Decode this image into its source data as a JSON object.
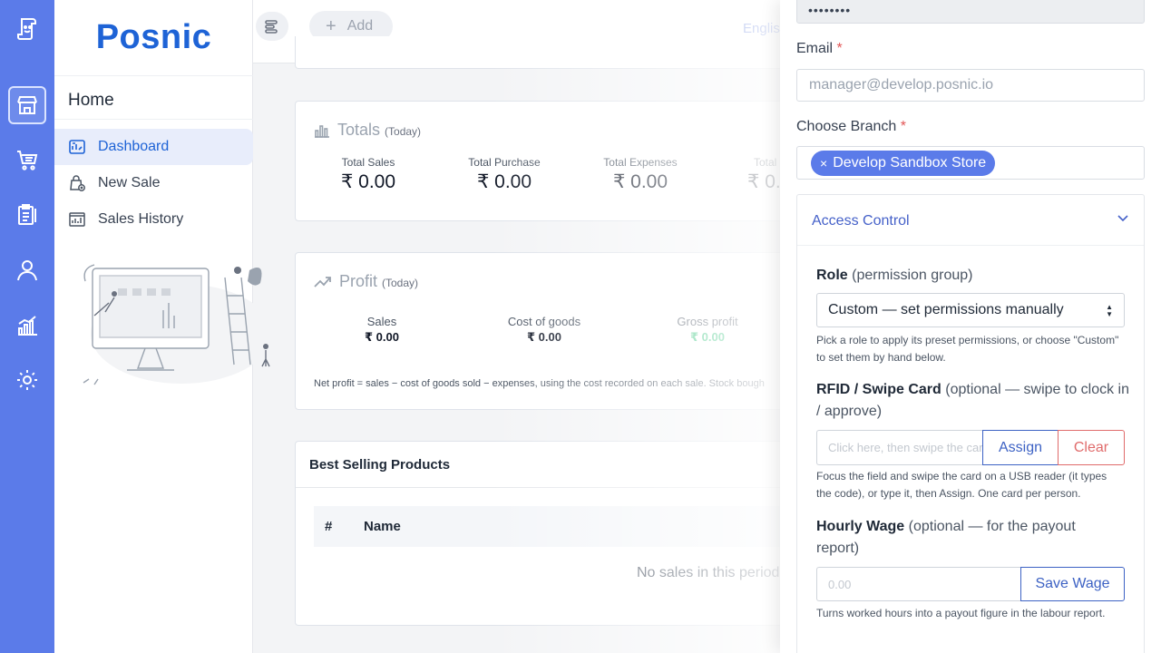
{
  "brand": {
    "name": "Posnic"
  },
  "sidebar": {
    "section_title": "Home",
    "items": [
      {
        "label": "Dashboard",
        "active": true
      },
      {
        "label": "New Sale",
        "active": false
      },
      {
        "label": "Sales History",
        "active": false
      }
    ]
  },
  "rail": {
    "icons": [
      "logo-icon",
      "store-icon",
      "cart-icon",
      "clipboard-icon",
      "user-icon",
      "chart-icon",
      "gear-icon"
    ]
  },
  "topbar": {
    "add_label": "Add",
    "language": "English"
  },
  "totals": {
    "title": "Totals",
    "period": "(Today)",
    "stats": [
      {
        "label": "Total Sales",
        "value": "₹ 0.00"
      },
      {
        "label": "Total Purchase",
        "value": "₹ 0.00"
      },
      {
        "label": "Total Expenses",
        "value": "₹ 0.00"
      },
      {
        "label": "Total",
        "value": "₹ 0."
      }
    ]
  },
  "profit": {
    "title": "Profit",
    "period": "(Today)",
    "stats": [
      {
        "label": "Sales",
        "value": "₹ 0.00"
      },
      {
        "label": "Cost of goods",
        "value": "₹ 0.00"
      },
      {
        "label": "Gross profit",
        "value": "₹ 0.00"
      }
    ],
    "note": "Net profit = sales − cost of goods sold − expenses, using the cost recorded on each sale. Stock bough"
  },
  "best_selling": {
    "title": "Best Selling Products",
    "columns": [
      "#",
      "Name"
    ],
    "empty_text": "No sales in this period"
  },
  "form": {
    "password_masked": "••••••••",
    "email_label": "Email",
    "email_placeholder": "manager@develop.posnic.io",
    "branch_label": "Choose Branch",
    "branch_chip_x": "×",
    "branch_selected": "Develop Sandbox Store",
    "required_mark": "*",
    "access_control": {
      "title": "Access Control",
      "role_label": "Role",
      "role_sub": "(permission group)",
      "role_value": "Custom — set permissions manually",
      "role_help": "Pick a role to apply its preset permissions, or choose \"Custom\" to set them by hand below.",
      "rfid_label": "RFID / Swipe Card",
      "rfid_sub": "(optional — swipe to clock in / approve)",
      "rfid_placeholder": "Click here, then swipe the card",
      "assign_label": "Assign",
      "clear_label": "Clear",
      "rfid_help": "Focus the field and swipe the card on a USB reader (it types the code), or type it, then Assign. One card per person.",
      "wage_label": "Hourly Wage",
      "wage_sub": "(optional — for the payout report)",
      "wage_placeholder": "0.00",
      "wage_button": "Save Wage",
      "wage_help": "Turns worked hours into a payout figure in the labour report."
    }
  },
  "colors": {
    "rail": "#5b7be9",
    "brand": "#1e63d6",
    "accent": "#3d62c4",
    "danger": "#e06b6b",
    "success": "#34c47c"
  }
}
